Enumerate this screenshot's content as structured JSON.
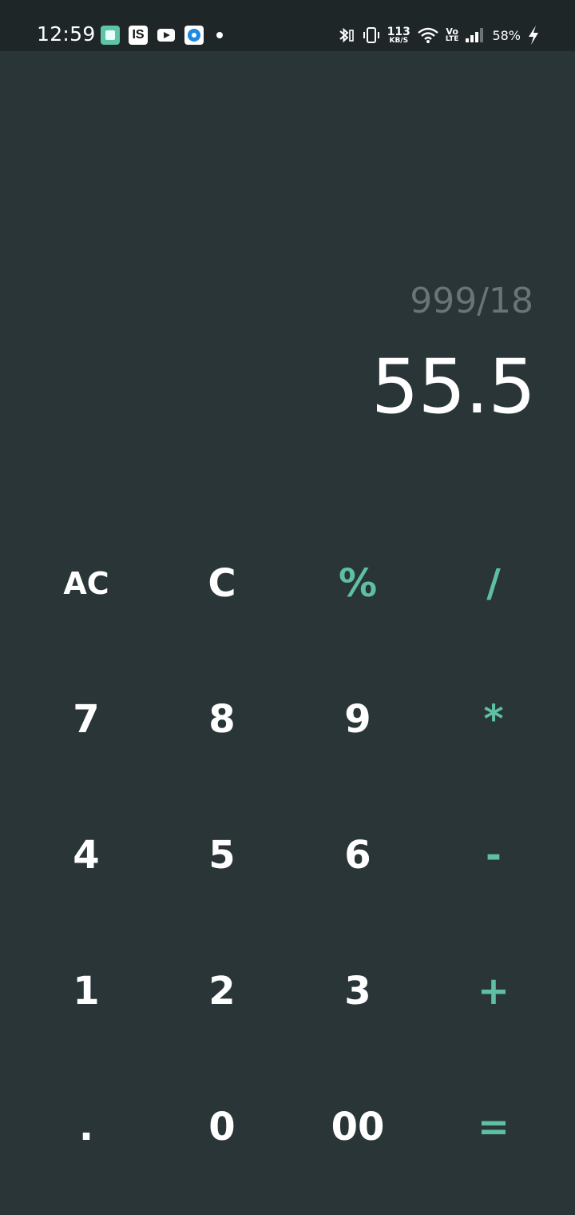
{
  "status_bar": {
    "time": "12:59",
    "notification_icons": [
      "tasks-app-icon",
      "is-app-icon",
      "youtube-icon",
      "browser-app-icon",
      "more-notifications-dot"
    ],
    "net_speed_value": "113",
    "net_speed_unit": "KB/S",
    "volte_top": "Vo",
    "volte_bottom": "LTE",
    "battery_percent": "58%"
  },
  "display": {
    "expression": "999/18",
    "result": "55.5"
  },
  "keypad": {
    "rows": [
      [
        "AC",
        "C",
        "%",
        "/"
      ],
      [
        "7",
        "8",
        "9",
        "*"
      ],
      [
        "4",
        "5",
        "6",
        "-"
      ],
      [
        "1",
        "2",
        "3",
        "+"
      ],
      [
        ".",
        "0",
        "00",
        "="
      ]
    ]
  },
  "colors": {
    "background": "#293537",
    "status_bar": "#1f2628",
    "accent_operator": "#5fbfa3",
    "expression_text": "#6a7476",
    "digit_text": "#ffffff"
  }
}
